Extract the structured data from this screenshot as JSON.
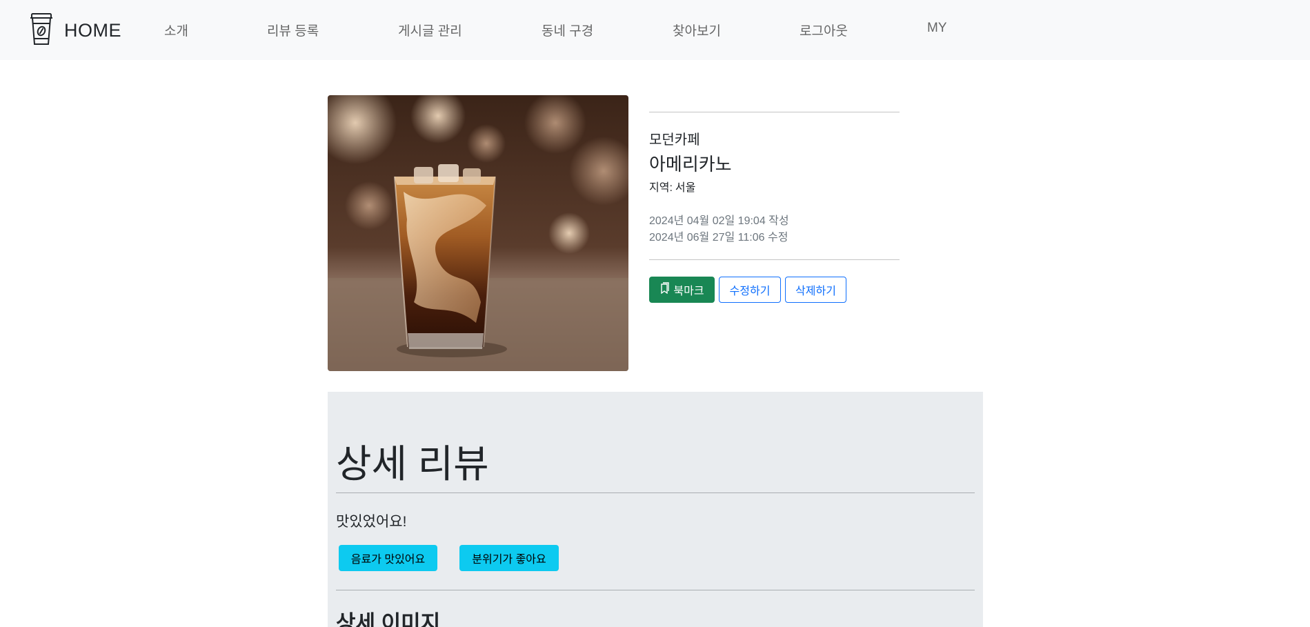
{
  "navbar": {
    "brand_label": "HOME",
    "brand_icon": "coffee-cup-icon",
    "links": [
      "소개",
      "리뷰 등록",
      "게시글 관리",
      "동네 구경",
      "찾아보기",
      "로그아웃",
      "MY"
    ]
  },
  "product": {
    "image_alt": "iced-coffee-photo",
    "store": "모던카페",
    "menu": "아메리카노",
    "region_label": "지역:",
    "region_value": "서울",
    "created": "2024년 04월 02일 19:04 작성",
    "modified": "2024년 06월 27일 11:06 수정"
  },
  "actions": {
    "bookmark_label": "북마크",
    "bookmark_icon": "bookmark-icon",
    "edit_label": "수정하기",
    "delete_label": "삭제하기"
  },
  "review": {
    "title": "상세 리뷰",
    "text": "맛있었어요!",
    "tags": [
      "음료가 맛있어요",
      "분위기가 좋아요"
    ],
    "detail_images_title": "상세 이미지"
  },
  "colors": {
    "bookmark": "#198754",
    "outline": "#0d6efd",
    "tag": "#0dcaf0",
    "panel": "#e9ecef",
    "navbar": "#f8f9fa"
  }
}
